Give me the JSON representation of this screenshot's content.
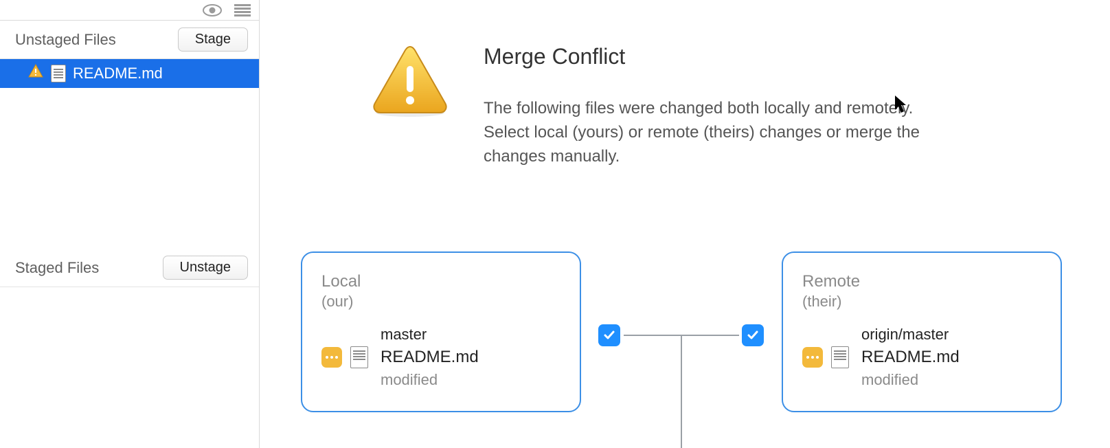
{
  "sidebar": {
    "unstaged_label": "Unstaged Files",
    "stage_button": "Stage",
    "staged_label": "Staged Files",
    "unstage_button": "Unstage",
    "files": [
      {
        "name": "README.md",
        "icon": "warning"
      }
    ]
  },
  "conflict": {
    "title": "Merge Conflict",
    "description": "The following files were changed both locally and remotely. Select local (yours) or remote (theirs) changes or merge the changes manually."
  },
  "merge": {
    "local": {
      "heading": "Local",
      "sub": "(our)",
      "branch": "master",
      "file": "README.md",
      "status": "modified",
      "checked": true
    },
    "remote": {
      "heading": "Remote",
      "sub": "(their)",
      "branch": "origin/master",
      "file": "README.md",
      "status": "modified",
      "checked": true
    }
  },
  "colors": {
    "selection": "#1a6fe8",
    "card_border": "#3c8fe6",
    "checkbox": "#1f8fff",
    "warning": "#f3b93b"
  }
}
